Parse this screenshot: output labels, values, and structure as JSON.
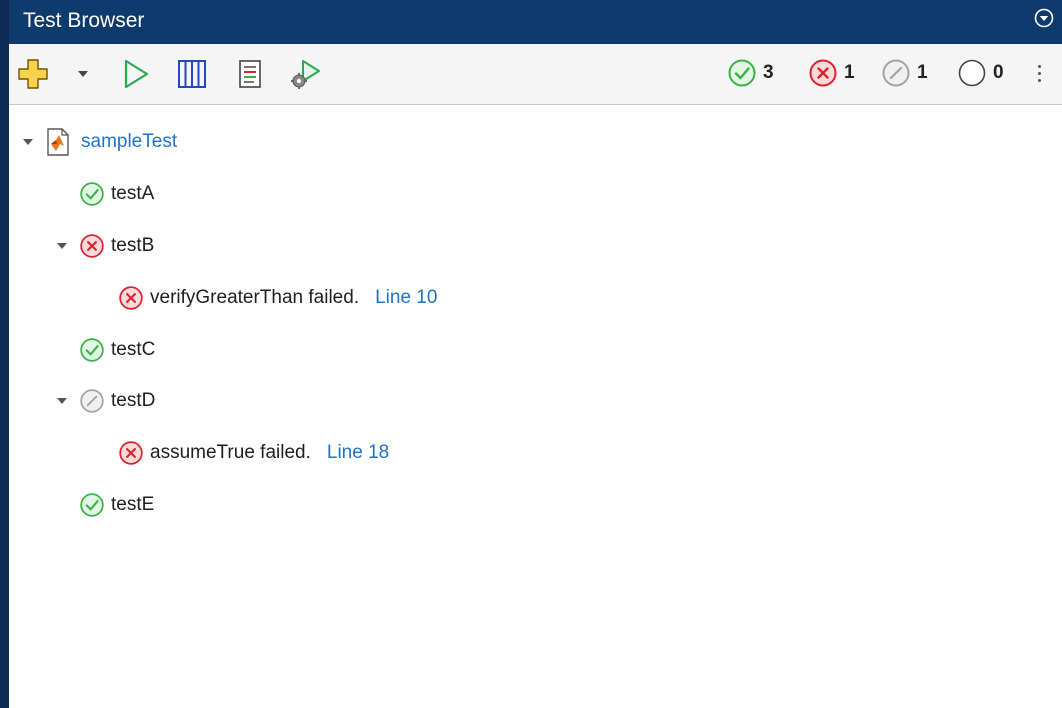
{
  "window": {
    "title": "Test Browser"
  },
  "toolbar": {
    "icons": [
      "add-tests-icon",
      "dropdown-arrow-icon",
      "run-icon",
      "columns-icon",
      "report-icon",
      "run-settings-icon"
    ],
    "counts": {
      "passed": "3",
      "failed": "1",
      "incomplete": "1",
      "not_run": "0"
    }
  },
  "tree": {
    "root": {
      "label": "sampleTest"
    },
    "tests": [
      {
        "label": "testA",
        "status": "passed"
      },
      {
        "label": "testB",
        "status": "failed",
        "diagnostic": {
          "text": "verifyGreaterThan failed.",
          "link": "Line 10"
        }
      },
      {
        "label": "testC",
        "status": "passed"
      },
      {
        "label": "testD",
        "status": "incomplete",
        "diagnostic": {
          "text": "assumeTrue failed.",
          "link": "Line 18"
        }
      },
      {
        "label": "testE",
        "status": "passed"
      }
    ]
  },
  "colors": {
    "title_bar": "#0e3a6e",
    "passed": "#3cb043",
    "failed": "#d9232e",
    "incomplete": "#9e9e9e",
    "link": "#1e73c8"
  }
}
